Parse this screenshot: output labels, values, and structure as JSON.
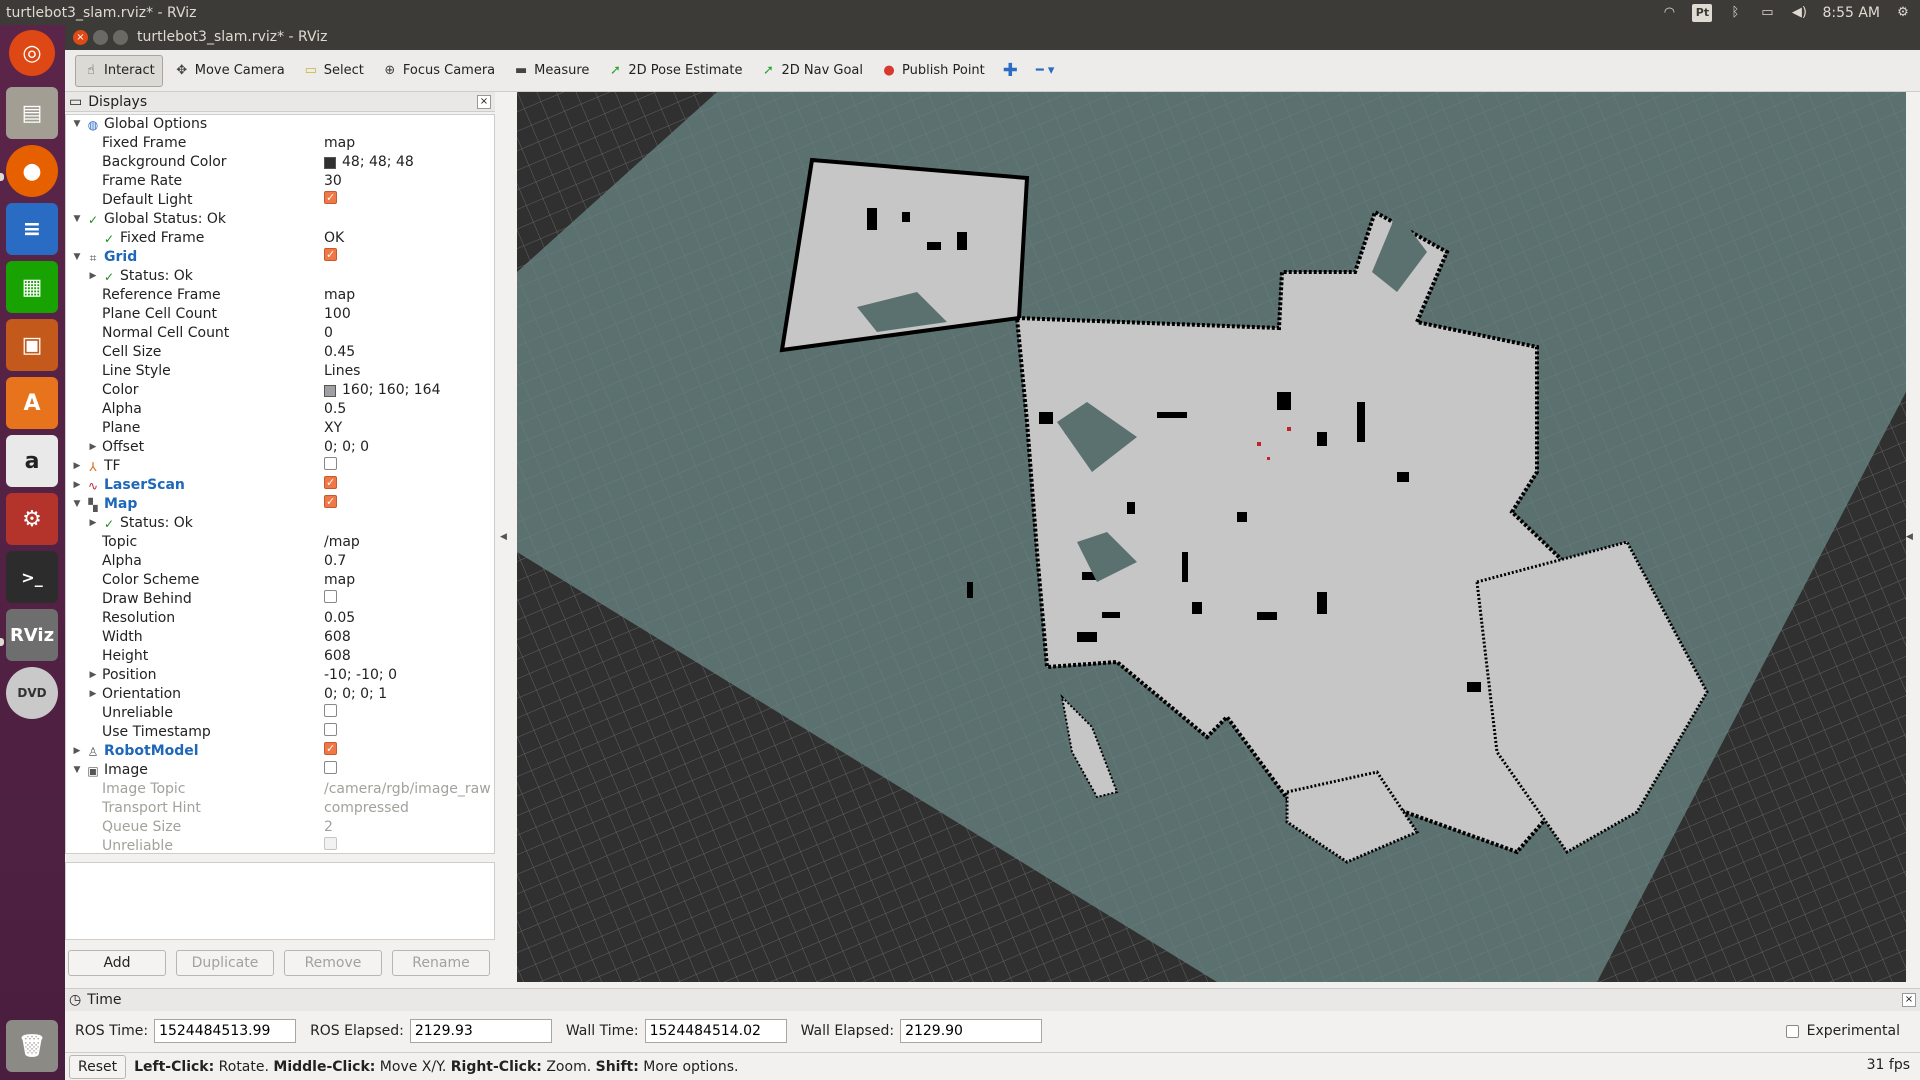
{
  "system": {
    "window_title": "turtlebot3_slam.rviz* - RViz",
    "clock": "8:55 AM",
    "keyboard_indicator": "Pt"
  },
  "launcher": {
    "items": [
      "Ubuntu Dash",
      "Files",
      "Firefox",
      "LibreOffice Writer",
      "LibreOffice Calc",
      "LibreOffice Impress",
      "Ubuntu Software",
      "Amazon",
      "System Settings",
      "Terminal",
      "RViz",
      "DVD",
      "Trash"
    ],
    "rviz_label": "RViz"
  },
  "toolbar": {
    "tools": [
      {
        "label": "Interact",
        "icon": "cursor-icon",
        "color": "#444444"
      },
      {
        "label": "Move Camera",
        "icon": "move-icon",
        "color": "#444444"
      },
      {
        "label": "Select",
        "icon": "select-icon",
        "color": "#c9b23a"
      },
      {
        "label": "Focus Camera",
        "icon": "focus-icon",
        "color": "#444444"
      },
      {
        "label": "Measure",
        "icon": "ruler-icon",
        "color": "#444444"
      },
      {
        "label": "2D Pose Estimate",
        "icon": "green-arrow-icon",
        "color": "#2da52d"
      },
      {
        "label": "2D Nav Goal",
        "icon": "green-arrow-icon",
        "color": "#2da52d"
      },
      {
        "label": "Publish Point",
        "icon": "pin-icon",
        "color": "#d9392c"
      }
    ]
  },
  "displays": {
    "title": "Displays",
    "rows": [
      {
        "indent": 0,
        "arrow": "▼",
        "icon": "globe-icon",
        "label": "Global Options",
        "style": "",
        "value": ""
      },
      {
        "indent": 1,
        "arrow": "",
        "icon": "",
        "label": "Fixed Frame",
        "style": "",
        "value": "map"
      },
      {
        "indent": 1,
        "arrow": "",
        "icon": "",
        "label": "Background Color",
        "style": "",
        "value": "48; 48; 48",
        "swatch": "#303030"
      },
      {
        "indent": 1,
        "arrow": "",
        "icon": "",
        "label": "Frame Rate",
        "style": "",
        "value": "30"
      },
      {
        "indent": 1,
        "arrow": "",
        "icon": "",
        "label": "Default Light",
        "style": "",
        "checkbox": "on"
      },
      {
        "indent": 0,
        "arrow": "▼",
        "icon": "check-icon",
        "label": "Global Status: Ok",
        "style": "",
        "value": ""
      },
      {
        "indent": 1,
        "arrow": "",
        "icon": "check-icon",
        "label": "Fixed Frame",
        "style": "",
        "value": "OK",
        "tight": true
      },
      {
        "indent": 0,
        "arrow": "▼",
        "icon": "grid-icon",
        "label": "Grid",
        "style": "blue",
        "checkbox": "on"
      },
      {
        "indent": 1,
        "arrow": "▶",
        "icon": "check-icon",
        "label": "Status: Ok",
        "style": "",
        "value": "",
        "tight": true
      },
      {
        "indent": 1,
        "arrow": "",
        "icon": "",
        "label": "Reference Frame",
        "style": "",
        "value": "map"
      },
      {
        "indent": 1,
        "arrow": "",
        "icon": "",
        "label": "Plane Cell Count",
        "style": "",
        "value": "100"
      },
      {
        "indent": 1,
        "arrow": "",
        "icon": "",
        "label": "Normal Cell Count",
        "style": "",
        "value": "0"
      },
      {
        "indent": 1,
        "arrow": "",
        "icon": "",
        "label": "Cell Size",
        "style": "",
        "value": "0.45"
      },
      {
        "indent": 1,
        "arrow": "",
        "icon": "",
        "label": "Line Style",
        "style": "",
        "value": "Lines"
      },
      {
        "indent": 1,
        "arrow": "",
        "icon": "",
        "label": "Color",
        "style": "",
        "value": "160; 160; 164",
        "swatch": "#a0a0a4"
      },
      {
        "indent": 1,
        "arrow": "",
        "icon": "",
        "label": "Alpha",
        "style": "",
        "value": "0.5"
      },
      {
        "indent": 1,
        "arrow": "",
        "icon": "",
        "label": "Plane",
        "style": "",
        "value": "XY"
      },
      {
        "indent": 1,
        "arrow": "▶",
        "icon": "",
        "label": "Offset",
        "style": "",
        "value": "0; 0; 0"
      },
      {
        "indent": 0,
        "arrow": "▶",
        "icon": "tf-icon",
        "label": "TF",
        "style": "",
        "checkbox": "off"
      },
      {
        "indent": 0,
        "arrow": "▶",
        "icon": "laserscan-icon",
        "label": "LaserScan",
        "style": "blue",
        "checkbox": "on"
      },
      {
        "indent": 0,
        "arrow": "▼",
        "icon": "map-icon",
        "label": "Map",
        "style": "blue",
        "checkbox": "on"
      },
      {
        "indent": 1,
        "arrow": "▶",
        "icon": "check-icon",
        "label": "Status: Ok",
        "style": "",
        "value": "",
        "tight": true
      },
      {
        "indent": 1,
        "arrow": "",
        "icon": "",
        "label": "Topic",
        "style": "",
        "value": "/map"
      },
      {
        "indent": 1,
        "arrow": "",
        "icon": "",
        "label": "Alpha",
        "style": "",
        "value": "0.7"
      },
      {
        "indent": 1,
        "arrow": "",
        "icon": "",
        "label": "Color Scheme",
        "style": "",
        "value": "map"
      },
      {
        "indent": 1,
        "arrow": "",
        "icon": "",
        "label": "Draw Behind",
        "style": "",
        "checkbox": "off"
      },
      {
        "indent": 1,
        "arrow": "",
        "icon": "",
        "label": "Resolution",
        "style": "",
        "value": "0.05"
      },
      {
        "indent": 1,
        "arrow": "",
        "icon": "",
        "label": "Width",
        "style": "",
        "value": "608"
      },
      {
        "indent": 1,
        "arrow": "",
        "icon": "",
        "label": "Height",
        "style": "",
        "value": "608"
      },
      {
        "indent": 1,
        "arrow": "▶",
        "icon": "",
        "label": "Position",
        "style": "",
        "value": "-10; -10; 0"
      },
      {
        "indent": 1,
        "arrow": "▶",
        "icon": "",
        "label": "Orientation",
        "style": "",
        "value": "0; 0; 0; 1"
      },
      {
        "indent": 1,
        "arrow": "",
        "icon": "",
        "label": "Unreliable",
        "style": "",
        "checkbox": "off"
      },
      {
        "indent": 1,
        "arrow": "",
        "icon": "",
        "label": "Use Timestamp",
        "style": "",
        "checkbox": "off"
      },
      {
        "indent": 0,
        "arrow": "▶",
        "icon": "robot-icon",
        "label": "RobotModel",
        "style": "blue",
        "checkbox": "on"
      },
      {
        "indent": 0,
        "arrow": "▼",
        "icon": "image-icon",
        "label": "Image",
        "style": "",
        "checkbox": "off"
      },
      {
        "indent": 1,
        "arrow": "",
        "icon": "",
        "label": "Image Topic",
        "style": "dim",
        "value": "/camera/rgb/image_raw"
      },
      {
        "indent": 1,
        "arrow": "",
        "icon": "",
        "label": "Transport Hint",
        "style": "dim",
        "value": "compressed"
      },
      {
        "indent": 1,
        "arrow": "",
        "icon": "",
        "label": "Queue Size",
        "style": "dim",
        "value": "2"
      },
      {
        "indent": 1,
        "arrow": "",
        "icon": "",
        "label": "Unreliable",
        "style": "dim",
        "checkbox": "off"
      }
    ],
    "buttons": [
      {
        "label": "Add",
        "enabled": true
      },
      {
        "label": "Duplicate",
        "enabled": false
      },
      {
        "label": "Remove",
        "enabled": false
      },
      {
        "label": "Rename",
        "enabled": false
      }
    ]
  },
  "time": {
    "title": "Time",
    "ros_time_label": "ROS Time:",
    "ros_time": "1524484513.99",
    "ros_elapsed_label": "ROS Elapsed:",
    "ros_elapsed": "2129.93",
    "wall_time_label": "Wall Time:",
    "wall_time": "1524484514.02",
    "wall_elapsed_label": "Wall Elapsed:",
    "wall_elapsed": "2129.90",
    "experimental_label": "Experimental"
  },
  "status": {
    "reset_label": "Reset",
    "hint_1": "Left-Click:",
    "hint_1b": " Rotate. ",
    "hint_2": "Middle-Click:",
    "hint_2b": " Move X/Y. ",
    "hint_3": "Right-Click:",
    "hint_3b": " Zoom. ",
    "hint_4": "Shift:",
    "hint_4b": " More options.",
    "fps": "31 fps"
  },
  "viewport": {
    "background": "#303030",
    "map_unknown": "#5b7170",
    "map_free": "#c6c6c6",
    "map_occupied": "#000000"
  }
}
